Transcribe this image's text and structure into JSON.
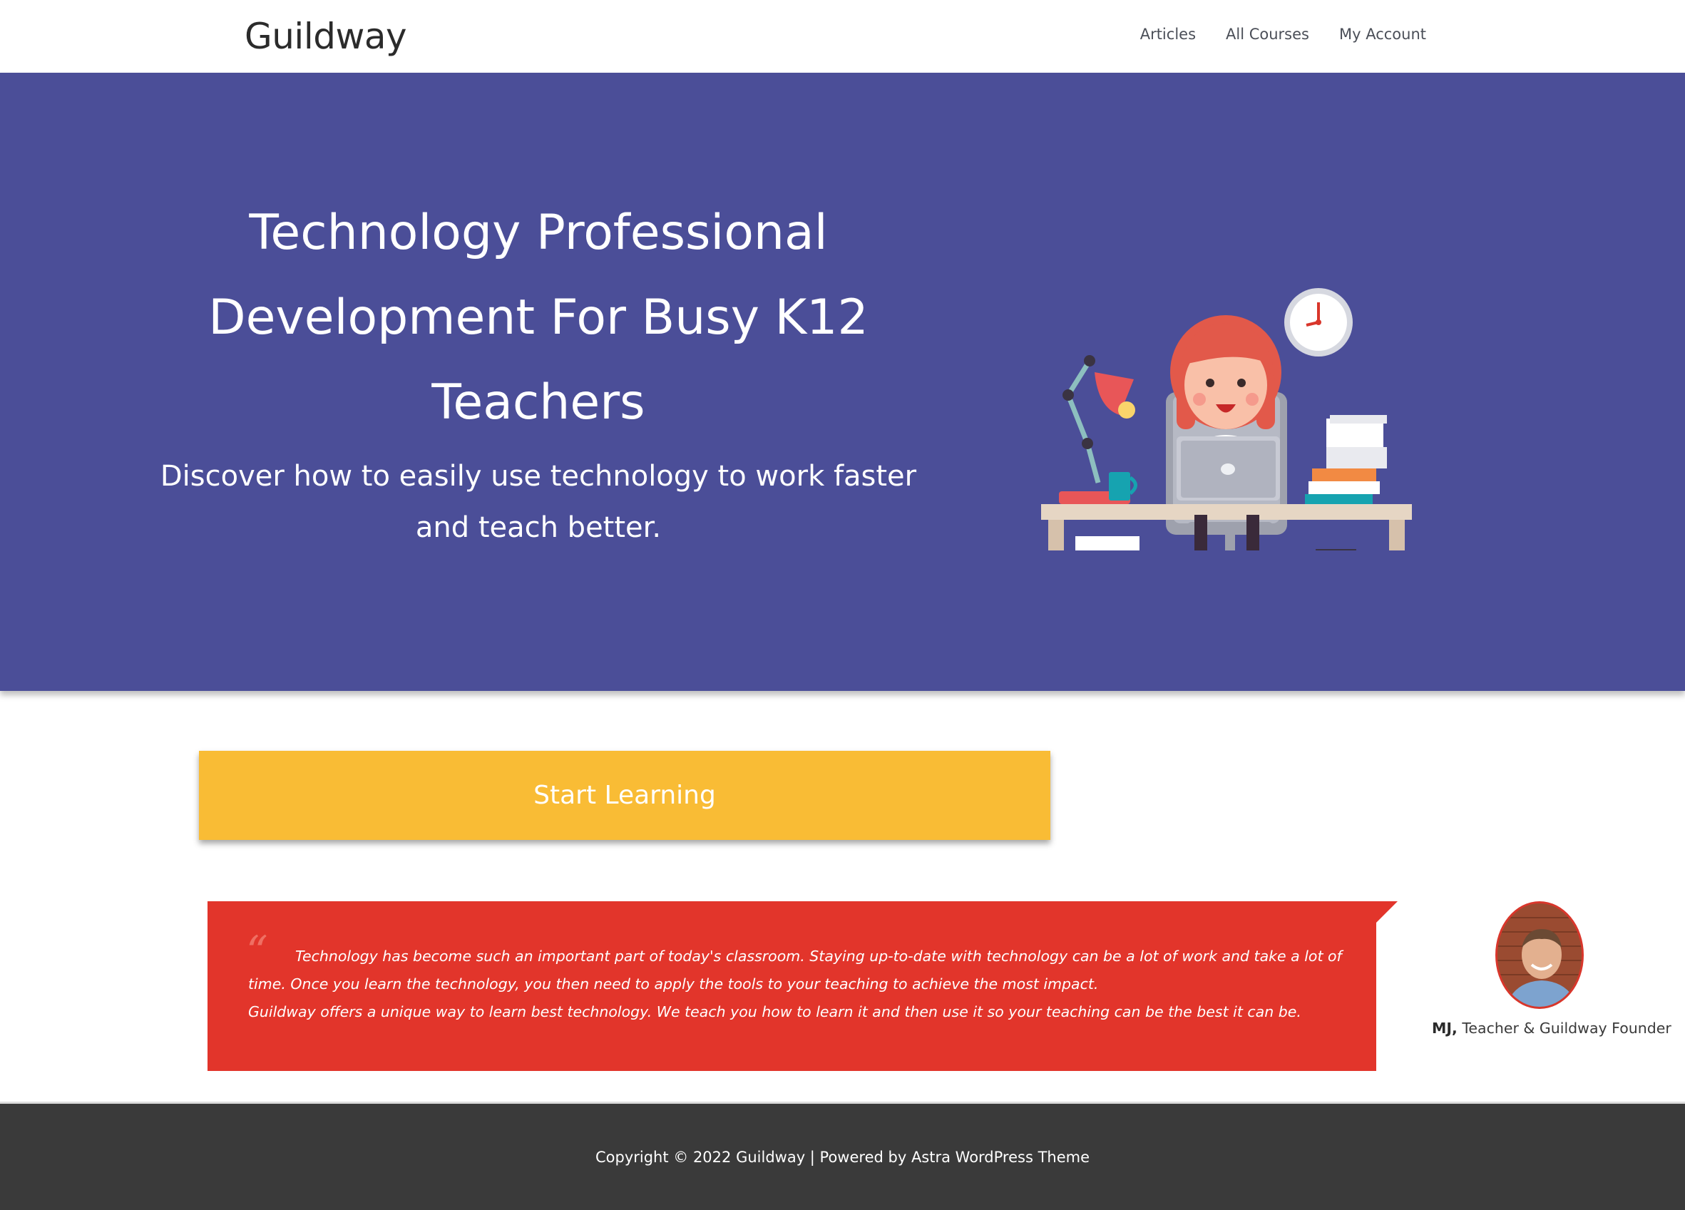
{
  "header": {
    "logo": "Guildway",
    "nav": [
      "Articles",
      "All Courses",
      "My Account"
    ]
  },
  "hero": {
    "title_lines": [
      "Technology Professional",
      "Development For Busy K12",
      "Teachers"
    ],
    "subtitle_lines": [
      "Discover how to easily use technology to work faster",
      "and teach better."
    ],
    "background_color": "#4b4e98"
  },
  "cta": {
    "label": "Start Learning",
    "color": "#f9bc35"
  },
  "testimonial": {
    "quote_mark": "“",
    "paragraph1": "Technology has become such an important part of today's classroom. Staying up-to-date with technology can be a lot of work and take a lot of time. Once you learn the technology, you then need to apply the tools to your teaching to achieve the most impact.",
    "paragraph2": "Guildway offers a unique way to learn best technology. We teach you how to learn it and then use it so your teaching can be the best it can be.",
    "author_name": "MJ,",
    "author_role": "Teacher & Guildway Founder",
    "background_color": "#e2352b"
  },
  "footer": {
    "copyright": "Copyright © 2022 Guildway | Powered by ",
    "theme_link": "Astra WordPress Theme"
  }
}
